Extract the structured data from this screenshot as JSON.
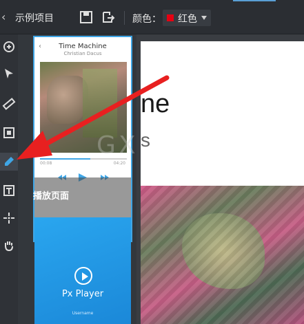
{
  "header": {
    "back_icon": "back-arrow-icon",
    "project_title": "示例项目",
    "color_label": "颜色：",
    "color_value": "红色",
    "color_hex": "#e60012"
  },
  "tools": [
    {
      "name": "link-icon"
    },
    {
      "name": "cursor-icon"
    },
    {
      "name": "ruler-icon"
    },
    {
      "name": "frame-icon"
    },
    {
      "name": "eyedropper-icon",
      "active": true
    },
    {
      "name": "text-icon"
    },
    {
      "name": "crosshair-icon"
    },
    {
      "name": "hand-icon"
    }
  ],
  "pages": [
    {
      "screen_title": "Time Machine",
      "screen_subtitle": "Christian Dacus",
      "time_left": "00:08",
      "time_right": "04:20",
      "progress": 0.58,
      "label": "播放页面"
    },
    {
      "app_name": "Px Player",
      "user_label": "Username"
    }
  ],
  "canvas": {
    "title_fragment": "ne",
    "subtitle_fragment": "s"
  },
  "colors": {
    "accent": "#3fa6e6",
    "arrow": "#e82020"
  }
}
